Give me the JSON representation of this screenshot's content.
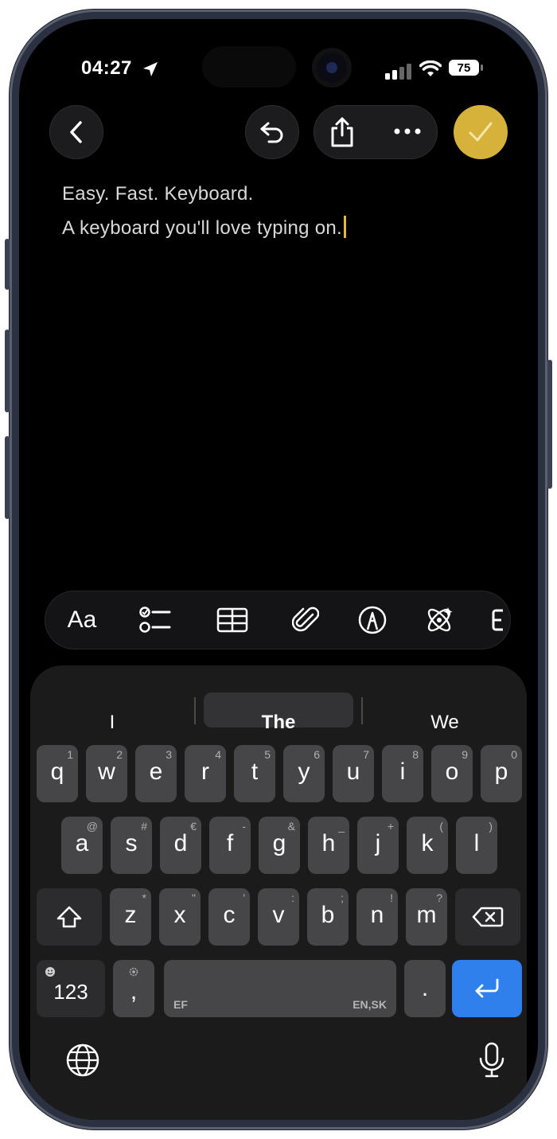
{
  "status": {
    "time": "04:27",
    "battery": "75",
    "icons": [
      "location-arrow-icon",
      "signal-icon",
      "wifi-icon",
      "battery-icon"
    ]
  },
  "nav": {
    "icons": [
      "back-chevron-icon",
      "undo-icon",
      "share-icon",
      "more-icon",
      "checkmark-icon"
    ]
  },
  "note": {
    "lines": [
      "Easy. Fast. Keyboard.",
      "A keyboard you'll love typing on."
    ]
  },
  "toolbar": {
    "format_label": "Aa",
    "icons": [
      "checklist-icon",
      "table-icon",
      "paperclip-icon",
      "markup-pen-icon",
      "apple-intelligence-icon",
      "partial-tool-icon"
    ]
  },
  "suggestions": [
    "I",
    "The",
    "We"
  ],
  "keys": {
    "row1": [
      {
        "letter": "q",
        "alt": "1"
      },
      {
        "letter": "w",
        "alt": "2"
      },
      {
        "letter": "e",
        "alt": "3"
      },
      {
        "letter": "r",
        "alt": "4"
      },
      {
        "letter": "t",
        "alt": "5"
      },
      {
        "letter": "y",
        "alt": "6"
      },
      {
        "letter": "u",
        "alt": "7"
      },
      {
        "letter": "i",
        "alt": "8"
      },
      {
        "letter": "o",
        "alt": "9"
      },
      {
        "letter": "p",
        "alt": "0"
      }
    ],
    "row2": [
      {
        "letter": "a",
        "alt": "@"
      },
      {
        "letter": "s",
        "alt": "#"
      },
      {
        "letter": "d",
        "alt": "€"
      },
      {
        "letter": "f",
        "alt": "-"
      },
      {
        "letter": "g",
        "alt": "&"
      },
      {
        "letter": "h",
        "alt": "_"
      },
      {
        "letter": "j",
        "alt": "+"
      },
      {
        "letter": "k",
        "alt": "("
      },
      {
        "letter": "l",
        "alt": ")"
      }
    ],
    "row3": [
      {
        "letter": "z",
        "alt": "*"
      },
      {
        "letter": "x",
        "alt": "\""
      },
      {
        "letter": "c",
        "alt": "'"
      },
      {
        "letter": "v",
        "alt": ":"
      },
      {
        "letter": "b",
        "alt": ";"
      },
      {
        "letter": "n",
        "alt": "!"
      },
      {
        "letter": "m",
        "alt": "?"
      }
    ],
    "numbers_label": "123",
    "comma": ",",
    "period": ".",
    "space_left": "EF",
    "space_right": "EN,SK"
  },
  "bottom": {
    "icons": [
      "globe-icon",
      "microphone-icon"
    ]
  },
  "colors": {
    "accent": "#d7b23a",
    "return": "#2f80ed",
    "key": "#464649",
    "key_dark": "#2c2c2e"
  }
}
